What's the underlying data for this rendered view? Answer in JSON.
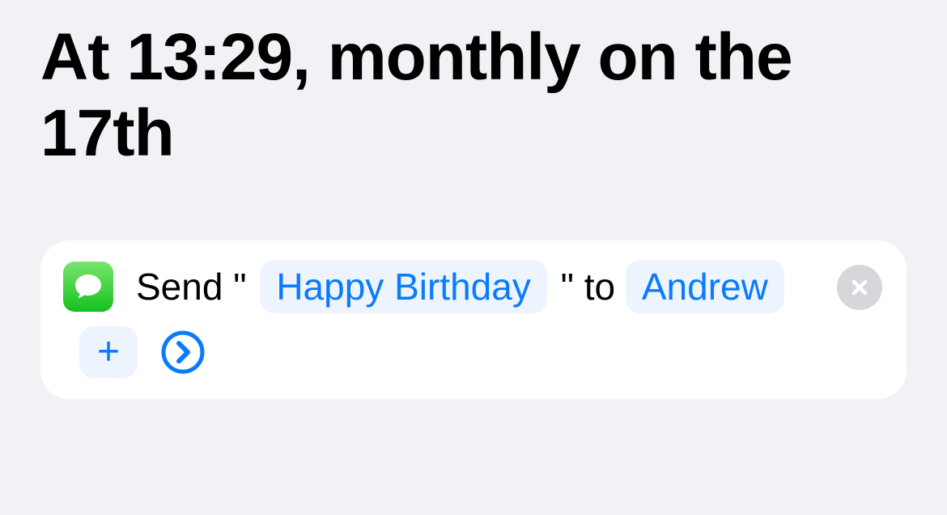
{
  "title": "At 13:29, monthly on the 17th",
  "action": {
    "app_icon": "messages-icon",
    "segments": {
      "send_prefix": "Send \" ",
      "send_suffix": " \" to ",
      "message": "Happy Birthday",
      "recipient": "Andrew"
    },
    "add_label": "+"
  }
}
